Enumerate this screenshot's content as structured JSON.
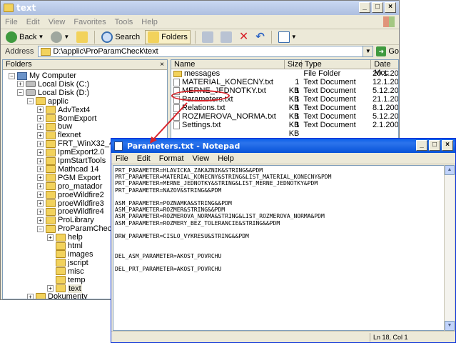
{
  "explorer": {
    "title": "text",
    "menu": [
      "File",
      "Edit",
      "View",
      "Favorites",
      "Tools",
      "Help"
    ],
    "toolbar": {
      "back_label": "Back",
      "search_label": "Search",
      "folders_label": "Folders"
    },
    "address": {
      "label": "Address",
      "value": "D:\\applic\\ProParamCheck\\text",
      "go_label": "Go"
    },
    "folders_header": "Folders",
    "tree": [
      {
        "label": "My Computer",
        "level": 1,
        "pm": "-",
        "icon": "computer-icon"
      },
      {
        "label": "Local Disk (C:)",
        "level": 2,
        "pm": "+",
        "icon": "drive-icon"
      },
      {
        "label": "Local Disk (D:)",
        "level": 2,
        "pm": "-",
        "icon": "drive-icon"
      },
      {
        "label": "applic",
        "level": 3,
        "pm": "-",
        "icon": "folder-icon"
      },
      {
        "label": "AdvText4",
        "level": 4,
        "pm": "+",
        "icon": "folder-icon"
      },
      {
        "label": "BomExport",
        "level": 4,
        "pm": "+",
        "icon": "folder-icon"
      },
      {
        "label": "buw",
        "level": 4,
        "pm": "+",
        "icon": "folder-icon"
      },
      {
        "label": "flexnet",
        "level": 4,
        "pm": "+",
        "icon": "folder-icon"
      },
      {
        "label": "FRT_WinX32_42.02",
        "level": 4,
        "pm": "+",
        "icon": "folder-icon"
      },
      {
        "label": "IpmExport2.0",
        "level": 4,
        "pm": "+",
        "icon": "folder-icon"
      },
      {
        "label": "IpmStartTools",
        "level": 4,
        "pm": "+",
        "icon": "folder-icon"
      },
      {
        "label": "Mathcad 14",
        "level": 4,
        "pm": "+",
        "icon": "folder-icon"
      },
      {
        "label": "PGM Export",
        "level": 4,
        "pm": "+",
        "icon": "folder-icon"
      },
      {
        "label": "pro_matador",
        "level": 4,
        "pm": "+",
        "icon": "folder-icon"
      },
      {
        "label": "proeWildfire2",
        "level": 4,
        "pm": "+",
        "icon": "folder-icon"
      },
      {
        "label": "proeWildfire3",
        "level": 4,
        "pm": "+",
        "icon": "folder-icon"
      },
      {
        "label": "proeWildfire4",
        "level": 4,
        "pm": "+",
        "icon": "folder-icon"
      },
      {
        "label": "ProLibrary",
        "level": 4,
        "pm": "+",
        "icon": "folder-icon"
      },
      {
        "label": "ProParamCheck",
        "level": 4,
        "pm": "-",
        "icon": "folder-icon"
      },
      {
        "label": "help",
        "level": 5,
        "pm": "+",
        "icon": "folder-icon"
      },
      {
        "label": "html",
        "level": 5,
        "pm": "",
        "icon": "folder-icon"
      },
      {
        "label": "images",
        "level": 5,
        "pm": "",
        "icon": "folder-icon"
      },
      {
        "label": "jscript",
        "level": 5,
        "pm": "",
        "icon": "folder-icon"
      },
      {
        "label": "misc",
        "level": 5,
        "pm": "",
        "icon": "folder-icon"
      },
      {
        "label": "temp",
        "level": 5,
        "pm": "",
        "icon": "folder-icon"
      },
      {
        "label": "text",
        "level": 5,
        "pm": "+",
        "icon": "folder-icon",
        "selected": true
      },
      {
        "label": "Dokumenty",
        "level": 3,
        "pm": "+",
        "icon": "folder-icon"
      }
    ],
    "file_columns": [
      "Name",
      "Size",
      "Type",
      "Date Moc"
    ],
    "files": [
      {
        "name": "messages",
        "size": "",
        "type": "File Folder",
        "date": "20.1.200",
        "kind": "folder"
      },
      {
        "name": "MATERIAL_KONECNY.txt",
        "size": "1 KB",
        "type": "Text Document",
        "date": "12.1.200",
        "kind": "text"
      },
      {
        "name": "MERNE_JEDNOTKY.txt",
        "size": "1 KB",
        "type": "Text Document",
        "date": "5.12.200",
        "kind": "text"
      },
      {
        "name": "Parameters.txt",
        "size": "1 KB",
        "type": "Text Document",
        "date": "21.1.200",
        "kind": "text"
      },
      {
        "name": "Relations.txt",
        "size": "1 KB",
        "type": "Text Document",
        "date": "8.1.2009",
        "kind": "text"
      },
      {
        "name": "ROZMEROVA_NORMA.txt",
        "size": "1 KB",
        "type": "Text Document",
        "date": "5.12.200",
        "kind": "text"
      },
      {
        "name": "Settings.txt",
        "size": "1 KB",
        "type": "Text Document",
        "date": "2.1.2009",
        "kind": "text"
      }
    ]
  },
  "notepad": {
    "title": "Parameters.txt - Notepad",
    "menu": [
      "File",
      "Edit",
      "Format",
      "View",
      "Help"
    ],
    "content": "PRT_PARAMETER=HLAVICKA_ZAKAZNIK&STRING&&PDM\nPRT_PARAMETER=MATERIAL_KONECNY&STRING&LIST_MATERIAL_KONECNY&PDM\nPRT_PARAMETER=MERNE_JEDNOTKY&STRING&LIST_MERNE_JEDNOTKY&PDM\nPRT_PARAMETER=NAZOV&STRING&&PDM\n\nASM_PARAMETER=POZNAMKA&STRING&&PDM\nASM_PARAMETER=ROZMER&STRING&&PDM\nASM_PARAMETER=ROZMEROVA_NORMA&STRING&LIST_ROZMEROVA_NORMA&PDM\nASM_PARAMETER=ROZMERY_BEZ_TOLERANCIE&STRING&&PDM\n\nDRW_PARAMETER=CISLO_VYKRESU&STRING&&PDM\n\n\nDEL_ASM_PARAMETER=AKOST_POVRCHU\n\nDEL_PRT_PARAMETER=AKOST_POVRCHU",
    "status": "Ln 18, Col 1"
  },
  "colors": {
    "highlight": "#d8232a",
    "notepad_title": "#0a5fe8",
    "folder": "#f2d25c"
  }
}
